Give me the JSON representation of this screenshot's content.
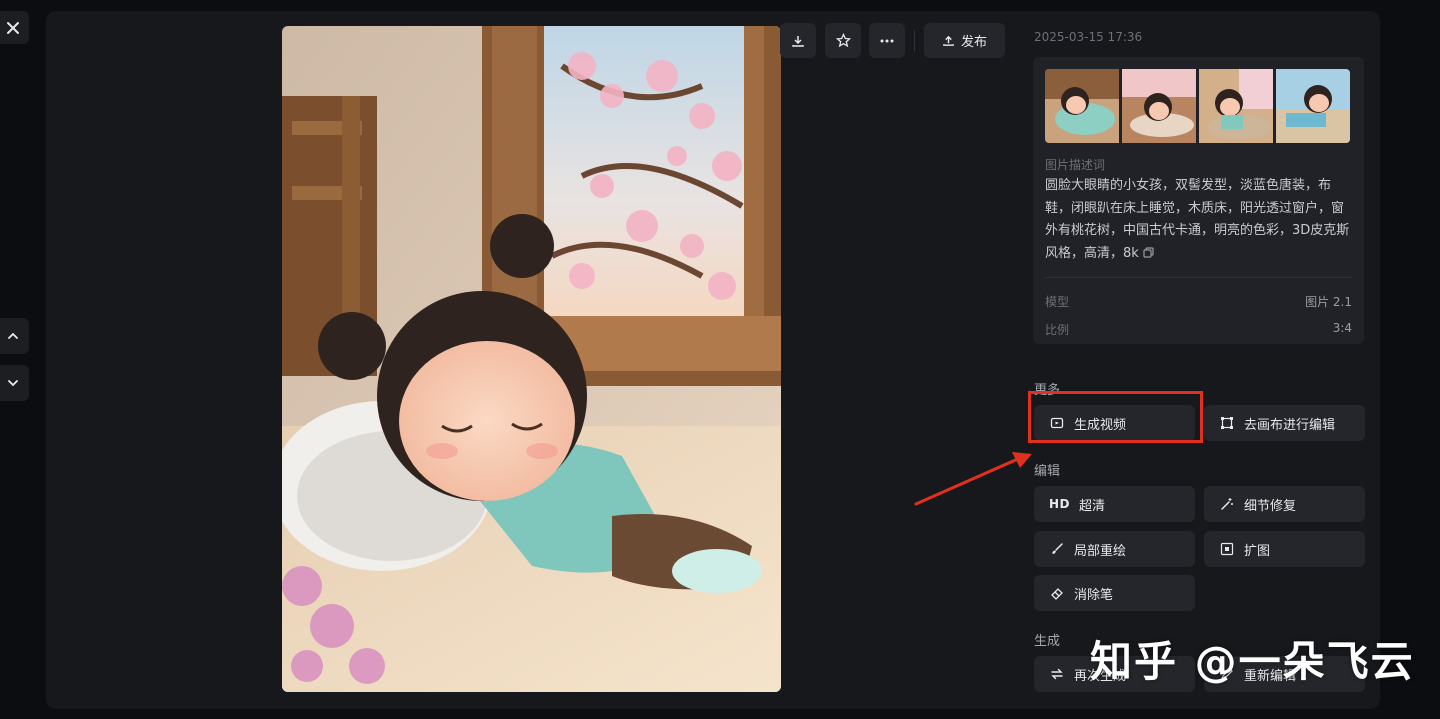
{
  "timestamp": "2025-03-15 17:36",
  "toolbar": {
    "download_icon": "download-icon",
    "favorite_icon": "star-icon",
    "more_icon": "more-icon",
    "publish_label": "发布"
  },
  "info": {
    "description_label": "图片描述词",
    "description": "圆脸大眼睛的小女孩，双髻发型，淡蓝色唐装，布鞋，闭眼趴在床上睡觉，木质床，阳光透过窗户，窗外有桃花树，中国古代卡通，明亮的色彩，3D皮克斯风格，高清，8k",
    "model_key": "模型",
    "model_value": "图片 2.1",
    "ratio_key": "比例",
    "ratio_value": "3:4"
  },
  "sections": {
    "more": "更多",
    "edit": "编辑",
    "generate": "生成"
  },
  "buttons": {
    "generate_video": "生成视频",
    "canvas_edit": "去画布进行编辑",
    "hd_prefix": "HD",
    "hd": "超清",
    "detail_fix": "细节修复",
    "inpaint": "局部重绘",
    "expand": "扩图",
    "eraser": "消除笔",
    "regenerate": "再次生成",
    "re_edit": "重新编辑"
  },
  "watermark": "知乎 @一朵飞云",
  "colors": {
    "background": "#0c0d10",
    "panel": "#17181c",
    "button": "#24262b",
    "highlight": "#e0301e"
  }
}
